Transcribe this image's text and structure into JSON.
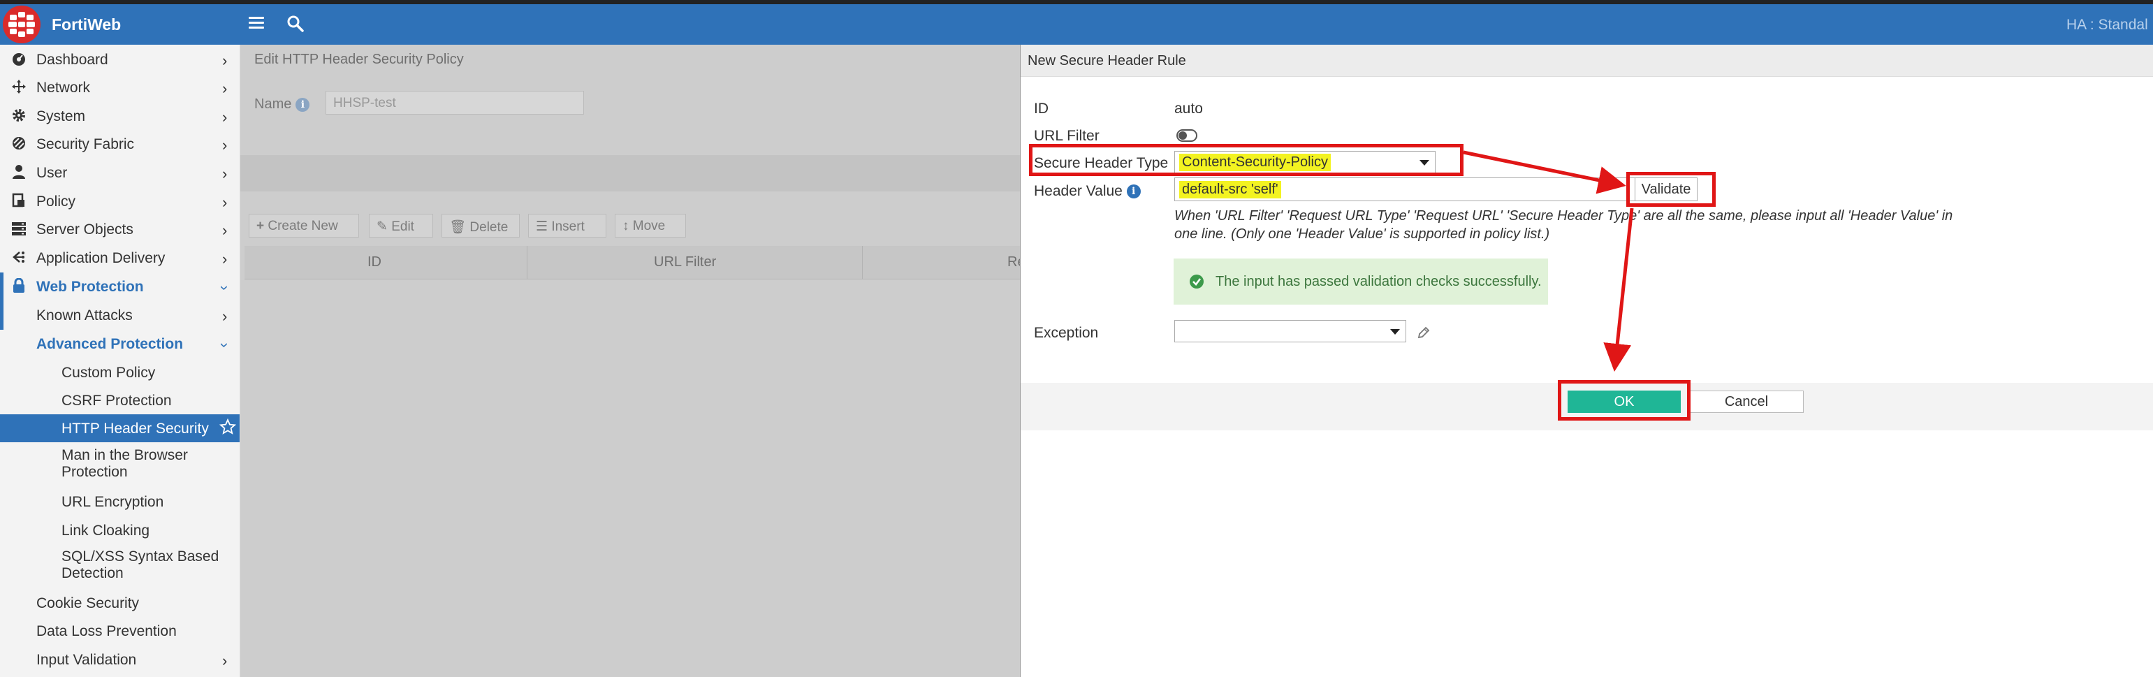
{
  "header": {
    "brand": "FortiWeb",
    "ha_status": "HA : Standal"
  },
  "sidebar": {
    "items": [
      {
        "label": "Dashboard",
        "icon": "dashboard-icon"
      },
      {
        "label": "Network",
        "icon": "network-icon"
      },
      {
        "label": "System",
        "icon": "gear-icon"
      },
      {
        "label": "Security Fabric",
        "icon": "security-fabric-icon"
      },
      {
        "label": "User",
        "icon": "user-icon"
      },
      {
        "label": "Policy",
        "icon": "policy-icon"
      },
      {
        "label": "Server Objects",
        "icon": "server-icon"
      },
      {
        "label": "Application Delivery",
        "icon": "app-delivery-icon"
      },
      {
        "label": "Web Protection",
        "icon": "lock-icon"
      },
      {
        "label": "Known Attacks"
      },
      {
        "label": "Advanced Protection"
      },
      {
        "label": "Custom Policy"
      },
      {
        "label": "CSRF Protection"
      },
      {
        "label": "HTTP Header Security"
      },
      {
        "label": "Man in the Browser",
        "label2": "Protection"
      },
      {
        "label": "URL Encryption"
      },
      {
        "label": "Link Cloaking"
      },
      {
        "label": "SQL/XSS Syntax Based",
        "label2": "Detection"
      },
      {
        "label": "Cookie Security"
      },
      {
        "label": "Data Loss Prevention"
      },
      {
        "label": "Input Validation"
      }
    ]
  },
  "background": {
    "title": "Edit HTTP Header Security Policy",
    "name_label": "Name",
    "name_value": "HHSP-test",
    "toolbar": {
      "create_new": "Create New",
      "edit": "Edit",
      "delete": "Delete",
      "insert": "Insert",
      "move": "Move"
    },
    "columns": [
      "ID",
      "URL Filter",
      "Requ"
    ]
  },
  "modal": {
    "title": "New Secure Header Rule",
    "id_label": "ID",
    "id_value": "auto",
    "url_filter_label": "URL Filter",
    "secure_header_type_label": "Secure Header Type",
    "secure_header_type_value": "Content-Security-Policy",
    "header_value_label": "Header Value",
    "header_value_value": "default-src 'self'",
    "validate_label": "Validate",
    "hint_line1": "When 'URL Filter' 'Request URL Type' 'Request URL' 'Secure Header Type' are all the same, please input all 'Header Value' in",
    "hint_line2": "one line. (Only one 'Header Value' is supported in policy list.)",
    "success_message": "The input has passed validation checks successfully.",
    "exception_label": "Exception",
    "ok_label": "OK",
    "cancel_label": "Cancel"
  },
  "colors": {
    "header_blue": "#2f72b8",
    "ok_green": "#1fb696",
    "annotation_red": "#e01616",
    "highlight_yellow": "#f3f321"
  }
}
